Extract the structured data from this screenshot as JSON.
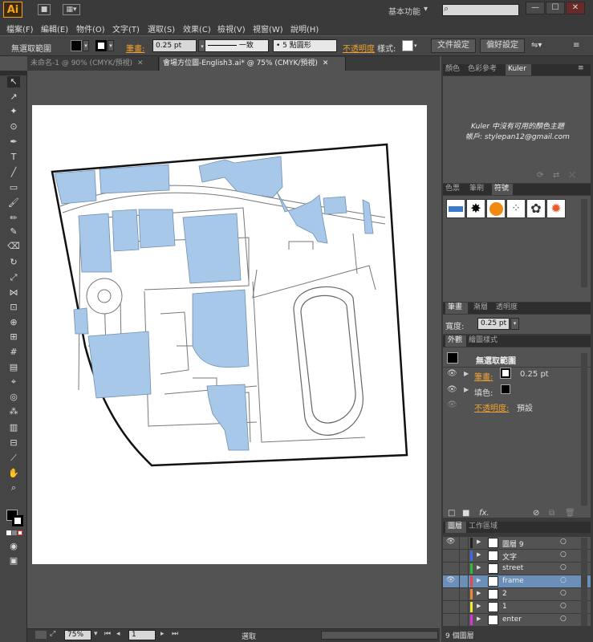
{
  "app": {
    "logo": "Ai",
    "workspace": "基本功能",
    "search_placeholder": ""
  },
  "window_buttons": {
    "minimize": "—",
    "maximize": "☐",
    "close": "✕"
  },
  "menu": [
    "檔案(F)",
    "編輯(E)",
    "物件(O)",
    "文字(T)",
    "選取(S)",
    "效果(C)",
    "檢視(V)",
    "視窗(W)",
    "說明(H)"
  ],
  "control": {
    "selection_label": "無選取範圍",
    "stroke_label": "筆畫:",
    "stroke_value": "0.25 pt",
    "profile_label": "一致",
    "brush_label": "5 點圓形",
    "opacity_label": "不透明度",
    "style_label": "樣式:",
    "doc_setup": "文件設定",
    "preferences": "偏好設定"
  },
  "tabs": [
    {
      "label": "未命名-1 @ 90% (CMYK/預視)",
      "active": false
    },
    {
      "label": "會場方位圖-English3.ai* @ 75% (CMYK/預視)",
      "active": true
    }
  ],
  "status": {
    "zoom": "75%",
    "page": "1",
    "mode": "選取"
  },
  "color_panel": {
    "tabs": [
      "顏色",
      "色彩參考",
      "Kuler"
    ],
    "message": "Kuler 中沒有可用的顏色主題",
    "account": "帳戶: stylepan12@gmail.com"
  },
  "swatch_panel": {
    "tabs": [
      "色票",
      "筆刷",
      "符號"
    ]
  },
  "stroke_panel": {
    "tabs": [
      "筆畫",
      "漸層",
      "透明度"
    ],
    "weight_label": "寬度:",
    "weight_value": "0.25 pt"
  },
  "appearance_panel": {
    "tabs": [
      "外觀",
      "繪圖樣式"
    ],
    "title": "無選取範圍",
    "stroke_label": "筆畫:",
    "stroke_value": "0.25 pt",
    "fill_label": "填色:",
    "opacity_label": "不透明度:",
    "opacity_value": "預設",
    "fx": "fx."
  },
  "layers_panel": {
    "tabs": [
      "圖層",
      "工作區域"
    ],
    "count": "9 個圖層",
    "layers": [
      {
        "name": "圖層 9",
        "color": "#222222",
        "selected": false,
        "visible": true
      },
      {
        "name": "文字",
        "color": "#4466ee",
        "selected": false,
        "visible": false
      },
      {
        "name": "street",
        "color": "#33bb33",
        "selected": false,
        "visible": false
      },
      {
        "name": "frame",
        "color": "#ee4444",
        "selected": true,
        "visible": true
      },
      {
        "name": "2",
        "color": "#ee8833",
        "selected": false,
        "visible": false
      },
      {
        "name": "1",
        "color": "#eeee33",
        "selected": false,
        "visible": false
      },
      {
        "name": "enter",
        "color": "#dd33dd",
        "selected": false,
        "visible": false
      }
    ]
  },
  "colors": {
    "accent": "#f0a030",
    "building": "#a8c8ea",
    "selected_layer": "#6a8fb8"
  }
}
